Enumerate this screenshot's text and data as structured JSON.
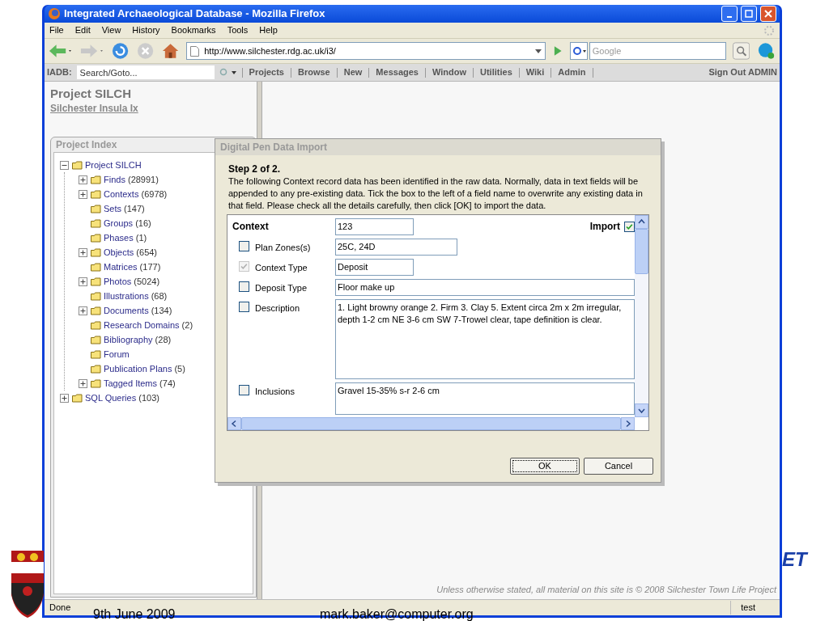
{
  "window": {
    "title": "Integrated Archaeological Database - Mozilla Firefox"
  },
  "menu": [
    "File",
    "Edit",
    "View",
    "History",
    "Bookmarks",
    "Tools",
    "Help"
  ],
  "address": {
    "value": "http://www.silchester.rdg.ac.uk/i3/"
  },
  "web_search": {
    "placeholder": "Google"
  },
  "app_bar": {
    "label": "IADB:",
    "search": {
      "placeholder": "Search/Goto..."
    },
    "links": [
      "Projects",
      "Browse",
      "New",
      "Messages",
      "Window",
      "Utilities",
      "Wiki",
      "Admin"
    ],
    "sign_out": "Sign Out ADMIN"
  },
  "project": {
    "title": "Project SILCH",
    "subtitle": "Silchester Insula Ix"
  },
  "index": {
    "title": "Project Index",
    "tree": [
      {
        "label": "Project SILCH",
        "kind": "folder",
        "expanded": true,
        "children": [
          {
            "label": "Finds",
            "count": "(28991)",
            "kind": "folder",
            "expanded": false
          },
          {
            "label": "Contexts",
            "count": "(6978)",
            "kind": "folder",
            "expanded": false
          },
          {
            "label": "Sets",
            "count": "(147)",
            "kind": "leaf"
          },
          {
            "label": "Groups",
            "count": "(16)",
            "kind": "leaf"
          },
          {
            "label": "Phases",
            "count": "(1)",
            "kind": "leaf"
          },
          {
            "label": "Objects",
            "count": "(654)",
            "kind": "folder",
            "expanded": false
          },
          {
            "label": "Matrices",
            "count": "(177)",
            "kind": "leaf"
          },
          {
            "label": "Photos",
            "count": "(5024)",
            "kind": "folder",
            "expanded": false
          },
          {
            "label": "Illustrations",
            "count": "(68)",
            "kind": "leaf"
          },
          {
            "label": "Documents",
            "count": "(134)",
            "kind": "folder",
            "expanded": false
          },
          {
            "label": "Research Domains",
            "count": "(2)",
            "kind": "leaf"
          },
          {
            "label": "Bibliography",
            "count": "(28)",
            "kind": "leaf"
          },
          {
            "label": "Forum",
            "kind": "leaf"
          },
          {
            "label": "Publication Plans",
            "count": "(5)",
            "kind": "leaf"
          },
          {
            "label": "Tagged Items",
            "count": "(74)",
            "kind": "folder",
            "expanded": false
          }
        ]
      },
      {
        "label": "SQL Queries",
        "count": "(103)",
        "kind": "folder",
        "expanded": false
      }
    ]
  },
  "dialog": {
    "title": "Digital Pen Data Import",
    "step": "Step 2 of 2.",
    "text": "The following Context record data has been identified in the raw data. Normally, data in text fields will be appended to any pre-existing data. Tick the box to the left of a field name to overwrite any existing data in that field. Please check all the details carefully, then click [OK] to import the data.",
    "context": {
      "label": "Context",
      "value": "123",
      "import_label": "Import",
      "import_checked": true
    },
    "fields": [
      {
        "label": "Plan Zones(s)",
        "value": "25C, 24D",
        "kind": "medium",
        "checked": false,
        "disabled": false
      },
      {
        "label": "Context Type",
        "value": "Deposit",
        "kind": "short",
        "checked": true,
        "disabled": true
      },
      {
        "label": "Deposit Type",
        "value": "Floor make up",
        "kind": "wide",
        "checked": false,
        "disabled": false
      },
      {
        "label": "Description",
        "value": "1. Light browny orange 2. Firm 3. Clay 5. Extent circa 2m x 2m irregular, depth 1-2 cm NE 3-6 cm SW 7-Trowel clear, tape definition is clear.",
        "kind": "area",
        "checked": false,
        "disabled": false
      },
      {
        "label": "Inclusions",
        "value": "Gravel 15-35% s-r 2-6 cm",
        "kind": "area_cut",
        "checked": false,
        "disabled": false
      }
    ],
    "buttons": [
      "OK",
      "Cancel"
    ]
  },
  "copyright": "Unless otherwise stated, all material on this site is © 2008 Silchester Town Life Project",
  "status_bar": {
    "left": "Done",
    "right": "test"
  },
  "slide": {
    "date": "9th June 2009",
    "email": "mark.baker@computer.org",
    "logo_text": "ET"
  }
}
